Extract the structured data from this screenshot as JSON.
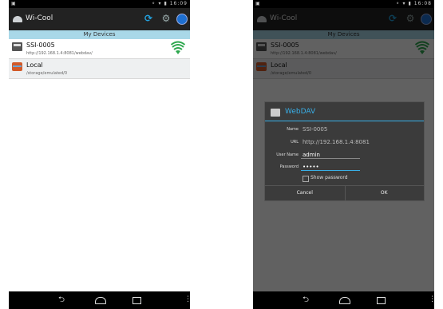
{
  "statusbar": {
    "left_icon": "▣",
    "icons": "⚬ ▾ ▮",
    "time_left": "16:09",
    "time_right": "16:08"
  },
  "app": {
    "title": "Wi-Cool"
  },
  "section": {
    "title": "My Devices"
  },
  "devices": [
    {
      "name": "SSI-0005",
      "path": "http://192.168.1.4:8081/webdav/",
      "icon": "drive-icon"
    },
    {
      "name": "Local",
      "path": "/storage/emulated/0",
      "icon": "books-icon"
    }
  ],
  "dialog": {
    "title": "WebDAV",
    "name_label": "Name",
    "name_value": "SSI-0005",
    "url_label": "URL",
    "url_value": "http://192.168.1.4:8081",
    "user_label": "User Name",
    "user_value": "admin",
    "password_label": "Password",
    "password_value": "•••••",
    "show_password": "Show password",
    "cancel": "Cancel",
    "ok": "OK"
  },
  "navbar": {
    "back": "⮌",
    "menu": "⋮"
  },
  "colors": {
    "accent": "#39aee6",
    "section_bg": "#a9d8e8",
    "wifi_green": "#2fa84f"
  }
}
